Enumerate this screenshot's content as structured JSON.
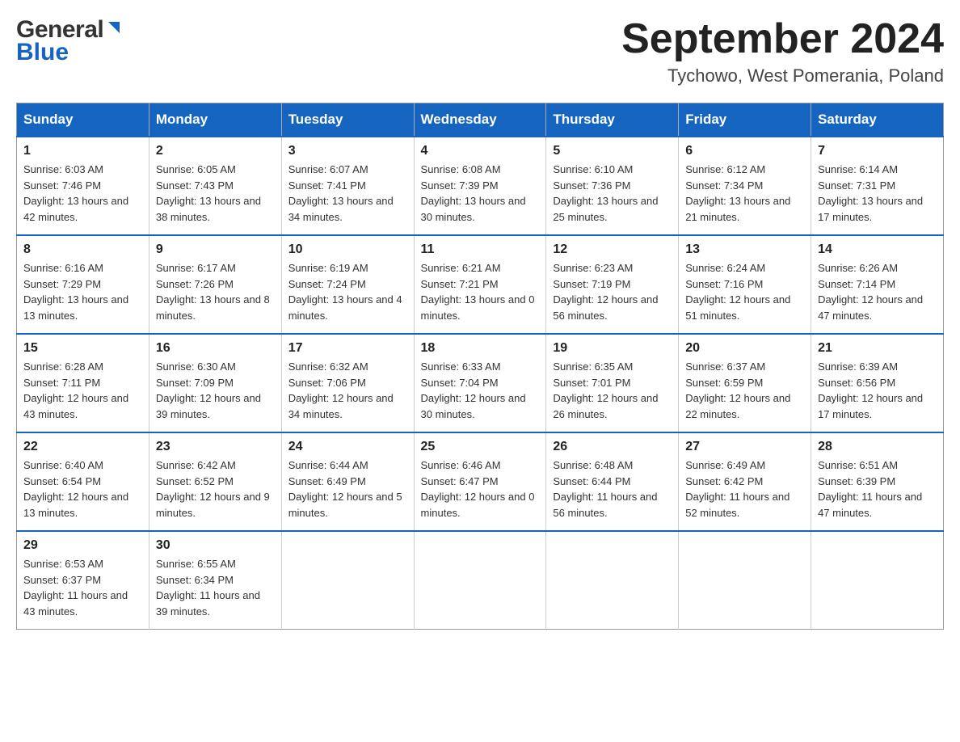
{
  "header": {
    "logo_general": "General",
    "logo_blue": "Blue",
    "month_title": "September 2024",
    "location": "Tychowo, West Pomerania, Poland"
  },
  "days_of_week": [
    "Sunday",
    "Monday",
    "Tuesday",
    "Wednesday",
    "Thursday",
    "Friday",
    "Saturday"
  ],
  "weeks": [
    [
      {
        "day": "1",
        "sunrise": "Sunrise: 6:03 AM",
        "sunset": "Sunset: 7:46 PM",
        "daylight": "Daylight: 13 hours and 42 minutes."
      },
      {
        "day": "2",
        "sunrise": "Sunrise: 6:05 AM",
        "sunset": "Sunset: 7:43 PM",
        "daylight": "Daylight: 13 hours and 38 minutes."
      },
      {
        "day": "3",
        "sunrise": "Sunrise: 6:07 AM",
        "sunset": "Sunset: 7:41 PM",
        "daylight": "Daylight: 13 hours and 34 minutes."
      },
      {
        "day": "4",
        "sunrise": "Sunrise: 6:08 AM",
        "sunset": "Sunset: 7:39 PM",
        "daylight": "Daylight: 13 hours and 30 minutes."
      },
      {
        "day": "5",
        "sunrise": "Sunrise: 6:10 AM",
        "sunset": "Sunset: 7:36 PM",
        "daylight": "Daylight: 13 hours and 25 minutes."
      },
      {
        "day": "6",
        "sunrise": "Sunrise: 6:12 AM",
        "sunset": "Sunset: 7:34 PM",
        "daylight": "Daylight: 13 hours and 21 minutes."
      },
      {
        "day": "7",
        "sunrise": "Sunrise: 6:14 AM",
        "sunset": "Sunset: 7:31 PM",
        "daylight": "Daylight: 13 hours and 17 minutes."
      }
    ],
    [
      {
        "day": "8",
        "sunrise": "Sunrise: 6:16 AM",
        "sunset": "Sunset: 7:29 PM",
        "daylight": "Daylight: 13 hours and 13 minutes."
      },
      {
        "day": "9",
        "sunrise": "Sunrise: 6:17 AM",
        "sunset": "Sunset: 7:26 PM",
        "daylight": "Daylight: 13 hours and 8 minutes."
      },
      {
        "day": "10",
        "sunrise": "Sunrise: 6:19 AM",
        "sunset": "Sunset: 7:24 PM",
        "daylight": "Daylight: 13 hours and 4 minutes."
      },
      {
        "day": "11",
        "sunrise": "Sunrise: 6:21 AM",
        "sunset": "Sunset: 7:21 PM",
        "daylight": "Daylight: 13 hours and 0 minutes."
      },
      {
        "day": "12",
        "sunrise": "Sunrise: 6:23 AM",
        "sunset": "Sunset: 7:19 PM",
        "daylight": "Daylight: 12 hours and 56 minutes."
      },
      {
        "day": "13",
        "sunrise": "Sunrise: 6:24 AM",
        "sunset": "Sunset: 7:16 PM",
        "daylight": "Daylight: 12 hours and 51 minutes."
      },
      {
        "day": "14",
        "sunrise": "Sunrise: 6:26 AM",
        "sunset": "Sunset: 7:14 PM",
        "daylight": "Daylight: 12 hours and 47 minutes."
      }
    ],
    [
      {
        "day": "15",
        "sunrise": "Sunrise: 6:28 AM",
        "sunset": "Sunset: 7:11 PM",
        "daylight": "Daylight: 12 hours and 43 minutes."
      },
      {
        "day": "16",
        "sunrise": "Sunrise: 6:30 AM",
        "sunset": "Sunset: 7:09 PM",
        "daylight": "Daylight: 12 hours and 39 minutes."
      },
      {
        "day": "17",
        "sunrise": "Sunrise: 6:32 AM",
        "sunset": "Sunset: 7:06 PM",
        "daylight": "Daylight: 12 hours and 34 minutes."
      },
      {
        "day": "18",
        "sunrise": "Sunrise: 6:33 AM",
        "sunset": "Sunset: 7:04 PM",
        "daylight": "Daylight: 12 hours and 30 minutes."
      },
      {
        "day": "19",
        "sunrise": "Sunrise: 6:35 AM",
        "sunset": "Sunset: 7:01 PM",
        "daylight": "Daylight: 12 hours and 26 minutes."
      },
      {
        "day": "20",
        "sunrise": "Sunrise: 6:37 AM",
        "sunset": "Sunset: 6:59 PM",
        "daylight": "Daylight: 12 hours and 22 minutes."
      },
      {
        "day": "21",
        "sunrise": "Sunrise: 6:39 AM",
        "sunset": "Sunset: 6:56 PM",
        "daylight": "Daylight: 12 hours and 17 minutes."
      }
    ],
    [
      {
        "day": "22",
        "sunrise": "Sunrise: 6:40 AM",
        "sunset": "Sunset: 6:54 PM",
        "daylight": "Daylight: 12 hours and 13 minutes."
      },
      {
        "day": "23",
        "sunrise": "Sunrise: 6:42 AM",
        "sunset": "Sunset: 6:52 PM",
        "daylight": "Daylight: 12 hours and 9 minutes."
      },
      {
        "day": "24",
        "sunrise": "Sunrise: 6:44 AM",
        "sunset": "Sunset: 6:49 PM",
        "daylight": "Daylight: 12 hours and 5 minutes."
      },
      {
        "day": "25",
        "sunrise": "Sunrise: 6:46 AM",
        "sunset": "Sunset: 6:47 PM",
        "daylight": "Daylight: 12 hours and 0 minutes."
      },
      {
        "day": "26",
        "sunrise": "Sunrise: 6:48 AM",
        "sunset": "Sunset: 6:44 PM",
        "daylight": "Daylight: 11 hours and 56 minutes."
      },
      {
        "day": "27",
        "sunrise": "Sunrise: 6:49 AM",
        "sunset": "Sunset: 6:42 PM",
        "daylight": "Daylight: 11 hours and 52 minutes."
      },
      {
        "day": "28",
        "sunrise": "Sunrise: 6:51 AM",
        "sunset": "Sunset: 6:39 PM",
        "daylight": "Daylight: 11 hours and 47 minutes."
      }
    ],
    [
      {
        "day": "29",
        "sunrise": "Sunrise: 6:53 AM",
        "sunset": "Sunset: 6:37 PM",
        "daylight": "Daylight: 11 hours and 43 minutes."
      },
      {
        "day": "30",
        "sunrise": "Sunrise: 6:55 AM",
        "sunset": "Sunset: 6:34 PM",
        "daylight": "Daylight: 11 hours and 39 minutes."
      },
      null,
      null,
      null,
      null,
      null
    ]
  ]
}
